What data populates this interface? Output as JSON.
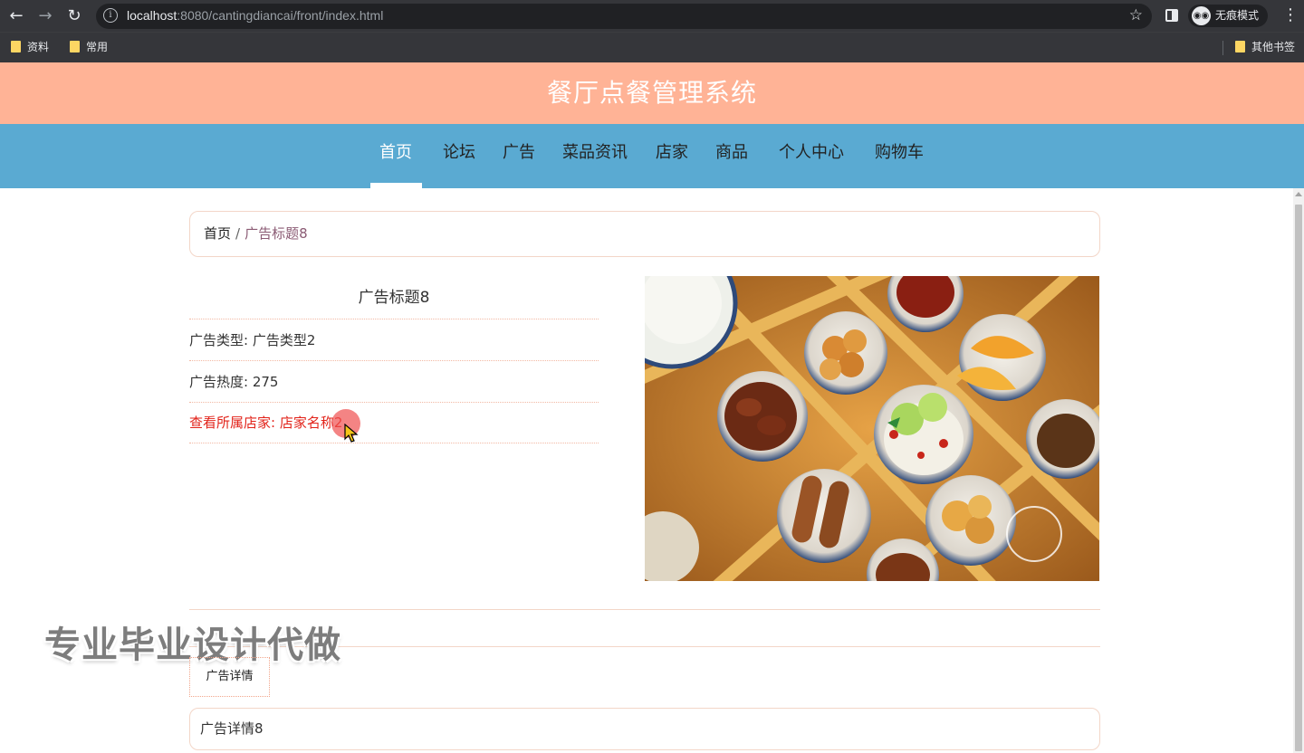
{
  "browser": {
    "url_host": "localhost",
    "url_rest": ":8080/cantingdiancai/front/index.html",
    "incognito_label": "无痕模式",
    "bookmarks": [
      "资料",
      "常用"
    ],
    "other_bookmarks": "其他书签"
  },
  "site": {
    "title": "餐厅点餐管理系统"
  },
  "nav": {
    "items": [
      "首页",
      "论坛",
      "广告",
      "菜品资讯",
      "店家",
      "商品",
      "个人中心",
      "购物车"
    ],
    "active_index": 0
  },
  "breadcrumb": {
    "home": "首页",
    "separator": "/",
    "current": "广告标题8"
  },
  "ad": {
    "title": "广告标题8",
    "type_label": "广告类型",
    "type_value": "广告类型2",
    "heat_label": "广告热度",
    "heat_value": "275",
    "shop_label": "查看所属店家",
    "shop_value": "店家名称2"
  },
  "detail": {
    "tab_label": "广告详情",
    "content": "广告详情8"
  },
  "watermark": "专业毕业设计代做",
  "colors": {
    "header_bg": "#ffb396",
    "nav_bg": "#5aaad2",
    "link_red": "#e2231a"
  },
  "icons": {
    "back": "arrow-left-icon",
    "forward": "arrow-right-icon",
    "reload": "reload-icon",
    "site_info": "info-icon",
    "bookmark_star": "star-icon",
    "side_panel": "side-panel-icon",
    "incognito": "incognito-icon",
    "menu": "kebab-menu-icon",
    "folder": "folder-icon"
  }
}
